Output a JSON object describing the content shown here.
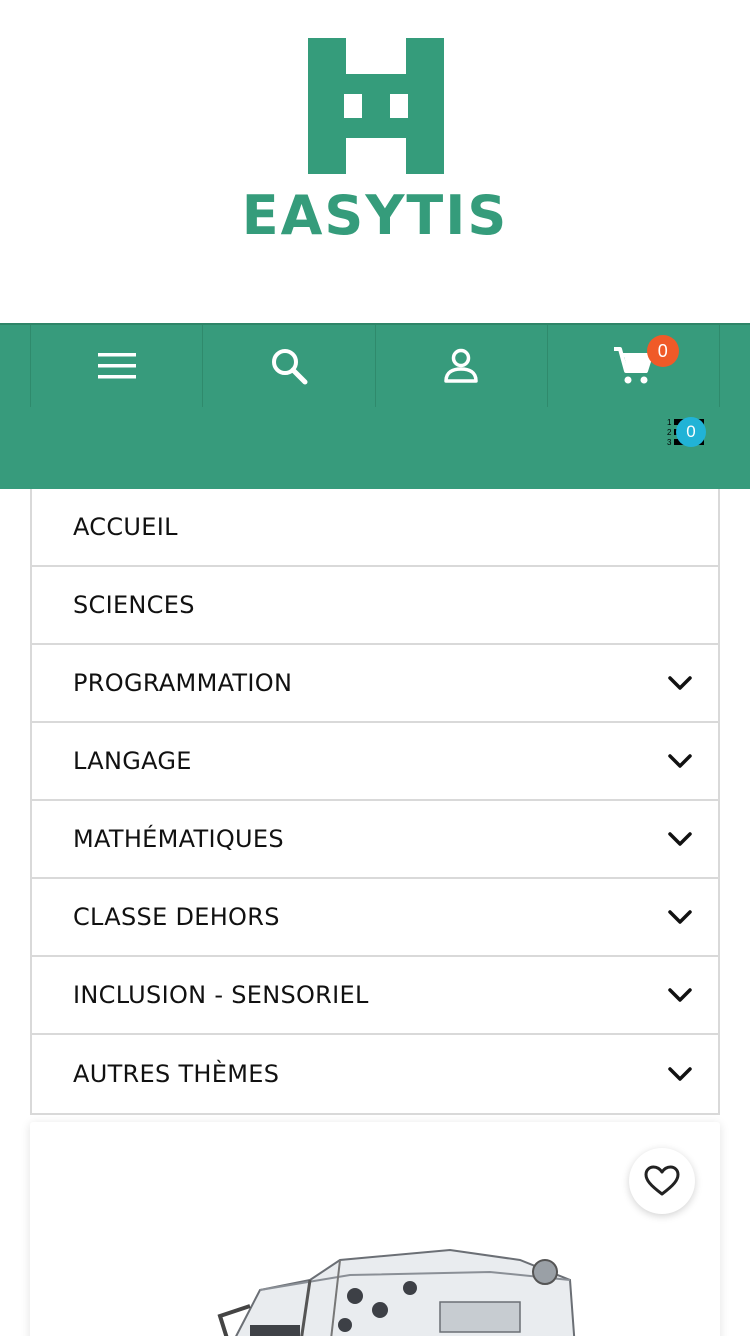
{
  "brand": {
    "name": "EASYTIS",
    "color": "#359c7b"
  },
  "header": {
    "bg_color": "#379b7c",
    "icons": [
      "menu-icon",
      "search-icon",
      "account-icon",
      "cart-icon"
    ],
    "cart_count": "0",
    "compare_count": "0",
    "compare_icon": "compare-list-icon"
  },
  "menu": {
    "items": [
      {
        "label": "ACCUEIL",
        "has_children": false
      },
      {
        "label": "SCIENCES",
        "has_children": false
      },
      {
        "label": "PROGRAMMATION",
        "has_children": true
      },
      {
        "label": "LANGAGE",
        "has_children": true
      },
      {
        "label": "MATHÉMATIQUES",
        "has_children": true
      },
      {
        "label": "CLASSE DEHORS",
        "has_children": true
      },
      {
        "label": "INCLUSION - SENSORIEL",
        "has_children": true
      },
      {
        "label": "AUTRES THÈMES",
        "has_children": true
      }
    ]
  },
  "product_card": {
    "wishlist_icon": "heart-icon",
    "image": "product-robot-kit-image"
  }
}
